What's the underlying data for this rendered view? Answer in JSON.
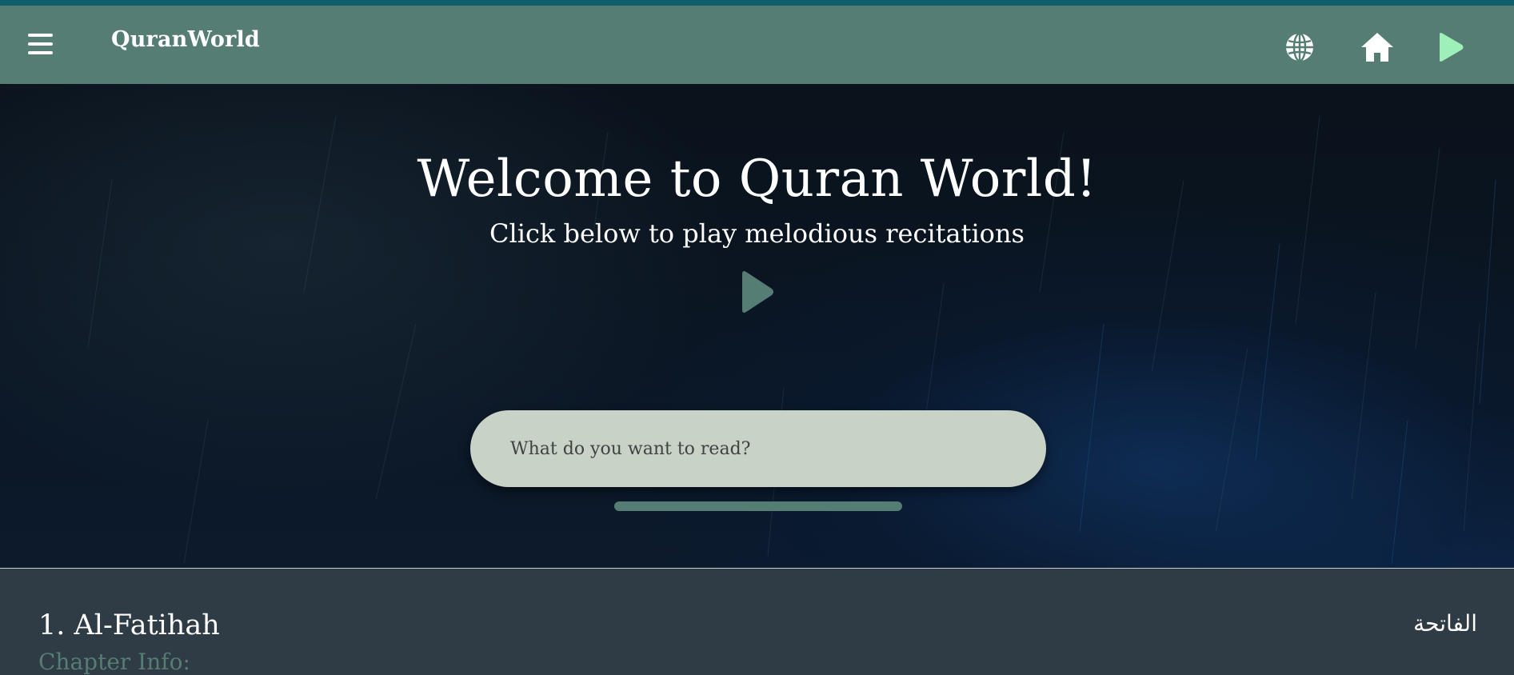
{
  "app": {
    "brand": "QuranWorld",
    "colors": {
      "accent": "#557d73",
      "top_strip": "#0e5f6b",
      "search_bg": "#c9d2c6",
      "section_bg": "#2f3b45",
      "play_icon_nav": "#9ff0b8"
    }
  },
  "navbar": {
    "menu_icon": "hamburger-menu-icon",
    "right_icons": [
      "globe-icon",
      "home-icon",
      "play-icon"
    ]
  },
  "hero": {
    "title": "Welcome to Quran World!",
    "subtitle": "Click below to play melodious recitations",
    "play_icon": "play-icon"
  },
  "search": {
    "placeholder": "What do you want to read?",
    "value": ""
  },
  "surahs": [
    {
      "title": "1. Al-Fatihah",
      "arabic": "الفاتحة",
      "info_label": "Chapter Info:"
    }
  ]
}
